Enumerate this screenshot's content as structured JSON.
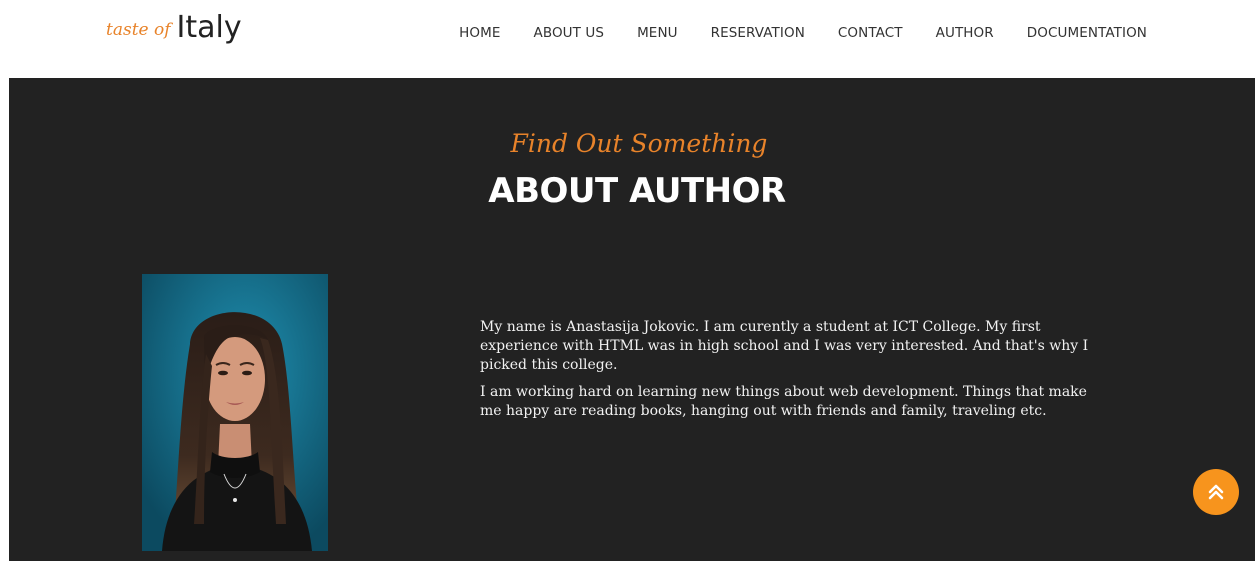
{
  "header": {
    "logo_script": "taste of",
    "logo_main": "Italy",
    "nav": [
      {
        "label": "HOME"
      },
      {
        "label": "ABOUT US"
      },
      {
        "label": "MENU"
      },
      {
        "label": "RESERVATION"
      },
      {
        "label": "CONTACT"
      },
      {
        "label": "AUTHOR"
      },
      {
        "label": "DOCUMENTATION"
      }
    ]
  },
  "section": {
    "subtitle": "Find Out Something",
    "title": "ABOUT AUTHOR",
    "paragraphs": [
      "My name is Anastasija Jokovic. I am curently a student at ICT College. My first experience with HTML was in high school and I was very interested. And that's why I picked this college.",
      "I am working hard on learning new things about web development. Things that make me happy are reading books, hanging out with friends and family, traveling etc."
    ]
  },
  "icons": {
    "scroll_top": "double-chevron-up-icon"
  },
  "colors": {
    "accent": "#f7941d",
    "dark_bg": "#222222",
    "script": "#e8832a"
  }
}
